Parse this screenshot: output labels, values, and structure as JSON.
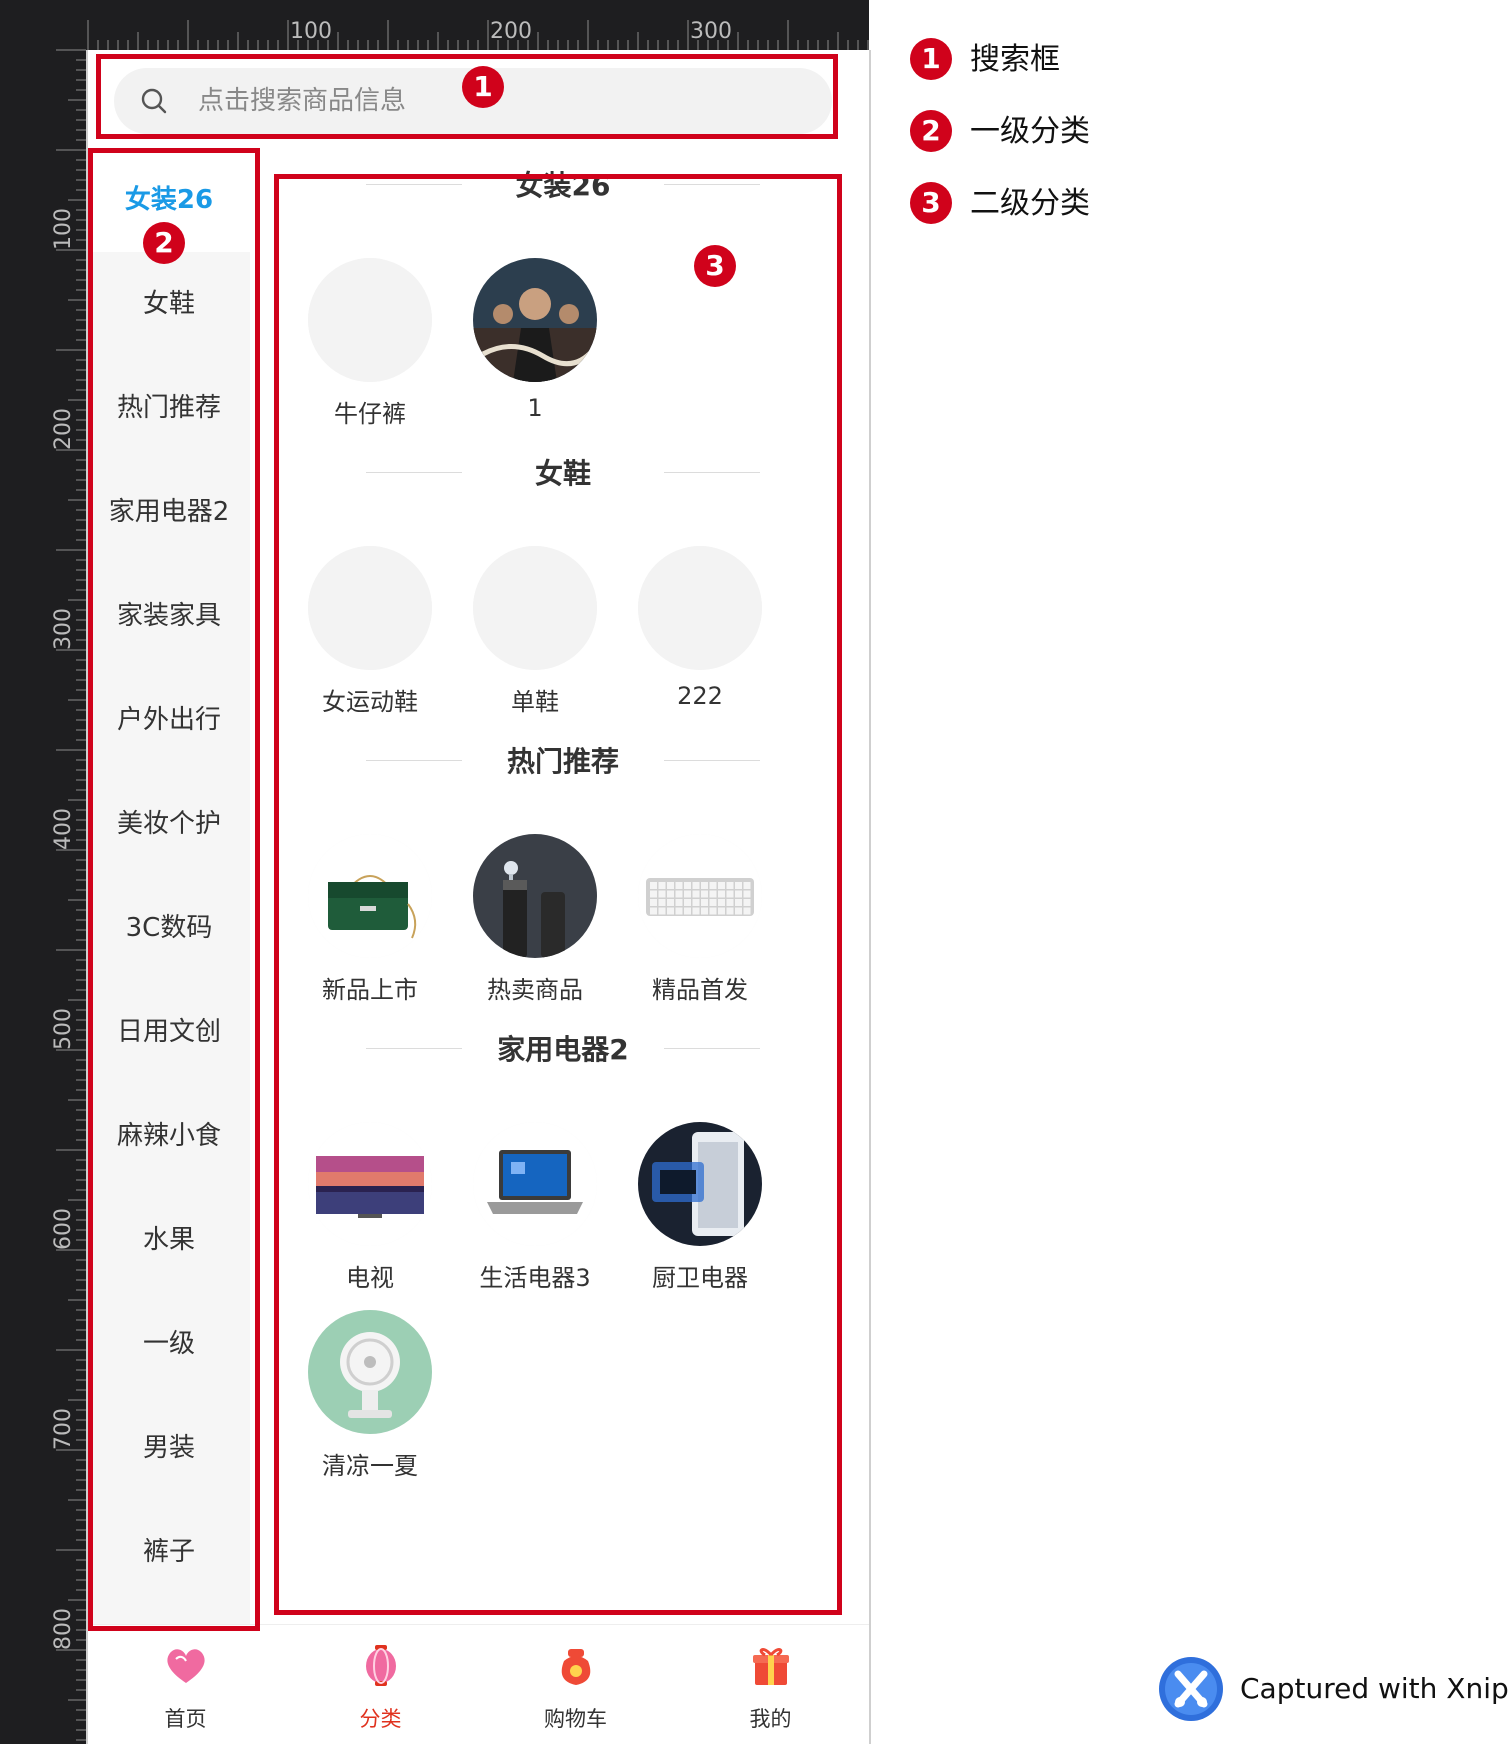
{
  "colors": {
    "accent": "#1a9ae6",
    "annotation_red": "#d0021b",
    "active_tab": "#e0321e"
  },
  "ruler": {
    "top_labels": [
      "100",
      "200",
      "300"
    ],
    "left_labels": [
      "100",
      "200",
      "300",
      "400",
      "500",
      "600",
      "700",
      "800"
    ]
  },
  "search": {
    "placeholder": "点击搜索商品信息",
    "icon": "search-icon"
  },
  "sidebar": {
    "items": [
      {
        "label": "女装26",
        "active": true
      },
      {
        "label": "女鞋"
      },
      {
        "label": "热门推荐"
      },
      {
        "label": "家用电器2"
      },
      {
        "label": "家装家具"
      },
      {
        "label": "户外出行"
      },
      {
        "label": "美妆个护"
      },
      {
        "label": "3C数码"
      },
      {
        "label": "日用文创"
      },
      {
        "label": "麻辣小食"
      },
      {
        "label": "水果"
      },
      {
        "label": "一级"
      },
      {
        "label": "男装"
      },
      {
        "label": "裤子"
      }
    ]
  },
  "content": {
    "sections": [
      {
        "title": "女装26",
        "items": [
          {
            "label": "牛仔裤",
            "image": "blank"
          },
          {
            "label": "1",
            "image": "movie-poster"
          }
        ]
      },
      {
        "title": "女鞋",
        "items": [
          {
            "label": "女运动鞋",
            "image": "blank"
          },
          {
            "label": "单鞋",
            "image": "blank"
          },
          {
            "label": "222",
            "image": "blank"
          }
        ]
      },
      {
        "title": "热门推荐",
        "items": [
          {
            "label": "新品上市",
            "image": "green-handbag"
          },
          {
            "label": "热卖商品",
            "image": "thermos-bottles"
          },
          {
            "label": "精品首发",
            "image": "keyboard"
          }
        ]
      },
      {
        "title": "家用电器2",
        "items": [
          {
            "label": "电视",
            "image": "television"
          },
          {
            "label": "生活电器3",
            "image": "laptop"
          },
          {
            "label": "厨卫电器",
            "image": "water-heater"
          },
          {
            "label": "清凉一夏",
            "image": "desk-fan"
          }
        ]
      }
    ]
  },
  "tabbar": {
    "tabs": [
      {
        "label": "首页",
        "icon": "heart-home-icon"
      },
      {
        "label": "分类",
        "icon": "lantern-category-icon",
        "active": true
      },
      {
        "label": "购物车",
        "icon": "money-bag-cart-icon"
      },
      {
        "label": "我的",
        "icon": "gift-profile-icon"
      }
    ]
  },
  "annotations": {
    "badges": [
      "1",
      "2",
      "3"
    ],
    "legend": [
      {
        "num": "1",
        "text": "搜索框"
      },
      {
        "num": "2",
        "text": "一级分类"
      },
      {
        "num": "3",
        "text": "二级分类"
      }
    ]
  },
  "watermark": {
    "text": "Captured with Xnip",
    "icon": "xnip-logo-icon"
  }
}
